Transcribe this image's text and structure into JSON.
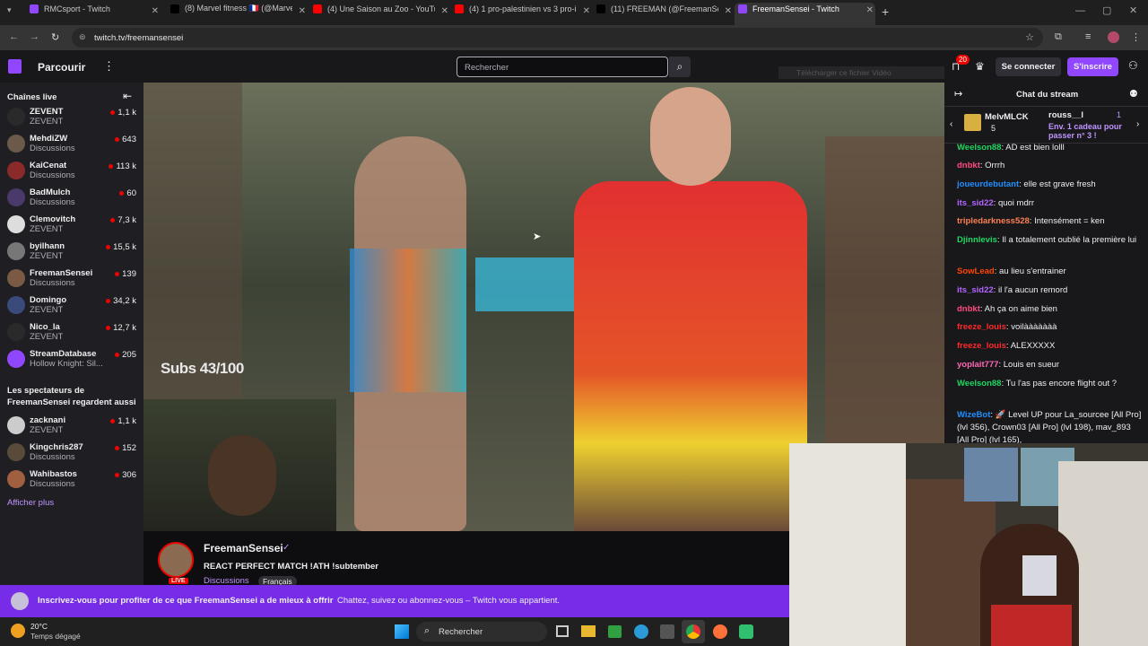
{
  "browser": {
    "tabs": [
      {
        "title": "RMCsport - Twitch",
        "active": false,
        "color": "#9146ff"
      },
      {
        "title": "(8) Marvel fitness 🇫🇷 (@Marvel_",
        "active": false,
        "color": "#000000"
      },
      {
        "title": "(4) Une Saison au Zoo - YouTub",
        "active": false,
        "color": "#ff0000"
      },
      {
        "title": "(4) 1 pro-palestinien vs 3 pro-is",
        "active": false,
        "color": "#ff0000"
      },
      {
        "title": "(11) FREEMAN (@FreemanSense",
        "active": false,
        "color": "#000000"
      },
      {
        "title": "FreemanSensei - Twitch",
        "active": true,
        "color": "#9146ff"
      }
    ],
    "url": "twitch.tv/freemansensei"
  },
  "header": {
    "browse": "Parcourir",
    "search_placeholder": "Rechercher",
    "notif_count": "20",
    "login": "Se connecter",
    "signup": "S'inscrire",
    "download_hint": "Télécharger ce fichier Vidéo"
  },
  "sidebar": {
    "title": "Chaînes live",
    "live": [
      {
        "name": "ZEVENT",
        "game": "ZEVENT",
        "viewers": "1,1 k",
        "color": "#2a2a2a"
      },
      {
        "name": "MehdiZW",
        "game": "Discussions",
        "viewers": "643",
        "color": "#6b5a4a"
      },
      {
        "name": "KaiCenat",
        "game": "Discussions",
        "viewers": "113 k",
        "color": "#8b2a2a"
      },
      {
        "name": "BadMulch",
        "game": "Discussions",
        "viewers": "60",
        "color": "#4a3a6b"
      },
      {
        "name": "Clemovitch",
        "game": "ZEVENT",
        "viewers": "7,3 k",
        "color": "#ddd"
      },
      {
        "name": "byilhann",
        "game": "ZEVENT",
        "viewers": "15,5 k",
        "color": "#777"
      },
      {
        "name": "FreemanSensei",
        "game": "Discussions",
        "viewers": "139",
        "color": "#7a5a45"
      },
      {
        "name": "Domingo",
        "game": "ZEVENT",
        "viewers": "34,2 k",
        "color": "#3a4a7a"
      },
      {
        "name": "Nico_la",
        "game": "ZEVENT",
        "viewers": "12,7 k",
        "color": "#2a2a2a"
      },
      {
        "name": "StreamDatabase",
        "game": "Hollow Knight: Sil...",
        "viewers": "205",
        "color": "#9146ff"
      }
    ],
    "also_title": "Les spectateurs de FreemanSensei regardent aussi",
    "also": [
      {
        "name": "zacknani",
        "game": "ZEVENT",
        "viewers": "1,1 k",
        "color": "#ccc"
      },
      {
        "name": "Kingchris287",
        "game": "Discussions",
        "viewers": "152",
        "color": "#5a4a3a"
      },
      {
        "name": "Wahibastos",
        "game": "Discussions",
        "viewers": "306",
        "color": "#a06040"
      }
    ],
    "show_more": "Afficher plus"
  },
  "player": {
    "overlay": "Subs 43/100"
  },
  "chat": {
    "title": "Chat du stream",
    "gift_user": "MelvMLCK",
    "gift_count": "5",
    "gift_user2": "rouss__l",
    "gift_count2": "1",
    "gift_cta": "Env. 1 cadeau pour passer n° 3 !",
    "messages": [
      {
        "user": "Weelson88",
        "color": "#1ed760",
        "text": "AD est bien lolll"
      },
      {
        "user": "dnbkt",
        "color": "#ff4a80",
        "text": "Orrrh"
      },
      {
        "user": "joueurdebutant",
        "color": "#1e90ff",
        "text": "elle est grave fresh"
      },
      {
        "user": "its_sid22",
        "color": "#b266ff",
        "text": "quoi mdrr"
      },
      {
        "user": "tripledarkness528",
        "color": "#ff7f50",
        "text": "Intensément = ken"
      },
      {
        "user": "Djinnlevis",
        "color": "#1ed760",
        "text": "Il a totalement oublié la première lui"
      },
      {
        "user": "SowLead",
        "color": "#ff4500",
        "text": "au lieu s'entrainer"
      },
      {
        "user": "its_sid22",
        "color": "#b266ff",
        "text": "il l'a aucun remord"
      },
      {
        "user": "dnbkt",
        "color": "#ff4a80",
        "text": "Ah ça on aime bien"
      },
      {
        "user": "freeze_louis",
        "color": "#ff2a2a",
        "text": "voilààààààà"
      },
      {
        "user": "freeze_louis",
        "color": "#ff2a2a",
        "text": "ALEXXXXX"
      },
      {
        "user": "yoplait777",
        "color": "#ff69b4",
        "text": "Louis en sueur"
      },
      {
        "user": "Weelson88",
        "color": "#1ed760",
        "text": "Tu l'as pas encore flight out ?"
      },
      {
        "user": "WizeBot",
        "color": "#1e90ff",
        "text": "🚀 Level UP pour La_sourcee [All Pro] (lvl 356), Crown03 [All Pro] (lvl 198), mav_893 [All Pro] (lvl 165),"
      }
    ]
  },
  "stream": {
    "name": "FreemanSensei",
    "title": "REACT PERFECT MATCH !ATH !subtember",
    "category": "Discussions",
    "tag": "Français",
    "live": "LIVE"
  },
  "banner": {
    "bold": "Inscrivez-vous pour profiter de ce que FreemanSensei a de mieux à offrir",
    "text": "Chattez, suivez ou abonnez-vous – Twitch vous appartient."
  },
  "taskbar": {
    "temp": "20°C",
    "weather": "Temps dégagé",
    "search": "Rechercher"
  }
}
